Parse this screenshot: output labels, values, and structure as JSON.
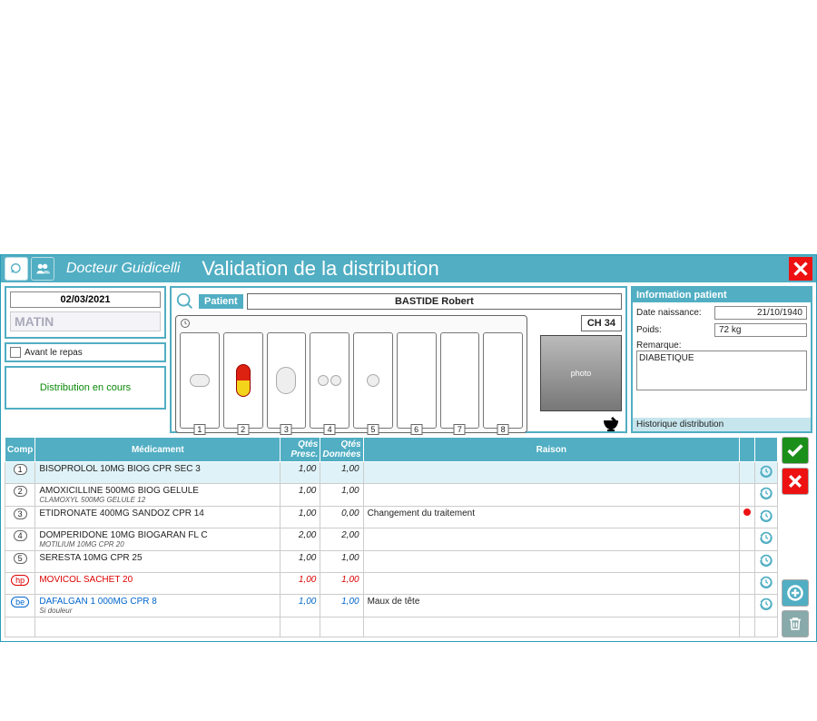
{
  "titlebar": {
    "doctor": "Docteur Guidicelli",
    "title": "Validation de la distribution"
  },
  "left": {
    "date": "02/03/2021",
    "moment": "MATIN",
    "meal_label": "Avant le repas",
    "status": "Distribution en cours"
  },
  "patient": {
    "label": "Patient",
    "name": "BASTIDE Robert",
    "room": "CH  34",
    "compartments": [
      "1",
      "2",
      "3",
      "4",
      "5",
      "6",
      "7",
      "8"
    ]
  },
  "info": {
    "title": "Information patient",
    "birth_label": "Date naissance:",
    "birth": "21/10/1940",
    "weight_label": "Poids:",
    "weight": "72 kg",
    "remark_label": "Remarque:",
    "remark": "DIABETIQUE",
    "history_link": "Historique distribution"
  },
  "table": {
    "headers": {
      "comp": "Comp",
      "med": "Médicament",
      "qty_presc": "Qtés Presc.",
      "qty_given": "Qtés Données",
      "reason": "Raison"
    },
    "rows": [
      {
        "comp": "1",
        "comp_style": "",
        "name": "BISOPROLOL 10MG BIOG CPR SEC 3",
        "sub": "",
        "presc": "1,00",
        "given": "1,00",
        "reason": "",
        "flag": "",
        "selected": true,
        "style": ""
      },
      {
        "comp": "2",
        "comp_style": "",
        "name": "AMOXICILLINE 500MG BIOG GELULE",
        "sub": "CLAMOXYL 500MG GELULE 12",
        "presc": "1,00",
        "given": "1,00",
        "reason": "",
        "flag": "",
        "selected": false,
        "style": ""
      },
      {
        "comp": "3",
        "comp_style": "",
        "name": "ETIDRONATE 400MG SANDOZ CPR 14",
        "sub": "",
        "presc": "1,00",
        "given": "0,00",
        "reason": "Changement du traitement",
        "flag": "red",
        "selected": false,
        "style": ""
      },
      {
        "comp": "4",
        "comp_style": "",
        "name": "DOMPERIDONE 10MG BIOGARAN FL C",
        "sub": "MOTILIUM 10MG CPR 20",
        "presc": "2,00",
        "given": "2,00",
        "reason": "",
        "flag": "",
        "selected": false,
        "style": ""
      },
      {
        "comp": "5",
        "comp_style": "",
        "name": "SERESTA 10MG CPR 25",
        "sub": "",
        "presc": "1,00",
        "given": "1,00",
        "reason": "",
        "flag": "",
        "selected": false,
        "style": ""
      },
      {
        "comp": "hp",
        "comp_style": "hp",
        "name": "MOVICOL SACHET 20",
        "sub": "",
        "presc": "1,00",
        "given": "1,00",
        "reason": "",
        "flag": "",
        "selected": false,
        "style": "red"
      },
      {
        "comp": "be",
        "comp_style": "be",
        "name": "DAFALGAN 1 000MG CPR 8",
        "sub": "Si douleur",
        "presc": "1,00",
        "given": "1,00",
        "reason": "Maux de tête",
        "flag": "",
        "selected": false,
        "style": "blue"
      }
    ]
  }
}
